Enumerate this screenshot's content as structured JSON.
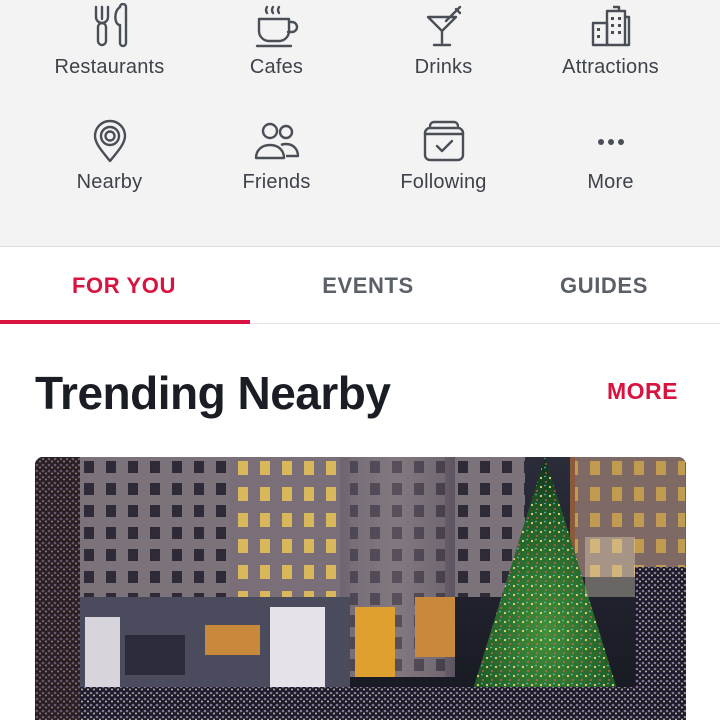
{
  "categories": [
    {
      "label": "Restaurants",
      "icon": "fork-knife-icon"
    },
    {
      "label": "Cafes",
      "icon": "coffee-cup-icon"
    },
    {
      "label": "Drinks",
      "icon": "cocktail-glass-icon"
    },
    {
      "label": "Attractions",
      "icon": "city-buildings-icon"
    },
    {
      "label": "Nearby",
      "icon": "location-pin-icon"
    },
    {
      "label": "Friends",
      "icon": "people-icon"
    },
    {
      "label": "Following",
      "icon": "bookmark-check-icon"
    },
    {
      "label": "More",
      "icon": "more-dots-icon"
    }
  ],
  "tabs": [
    {
      "label": "FOR YOU",
      "active": true
    },
    {
      "label": "EVENTS",
      "active": false
    },
    {
      "label": "GUIDES",
      "active": false
    }
  ],
  "section": {
    "title": "Trending Nearby",
    "more_label": "MORE"
  },
  "card": {
    "image": "christmas-tree-plaza-photo"
  },
  "colors": {
    "accent": "#d9133f",
    "category_bg": "#f3f3f4",
    "icon": "#4a4f57"
  }
}
